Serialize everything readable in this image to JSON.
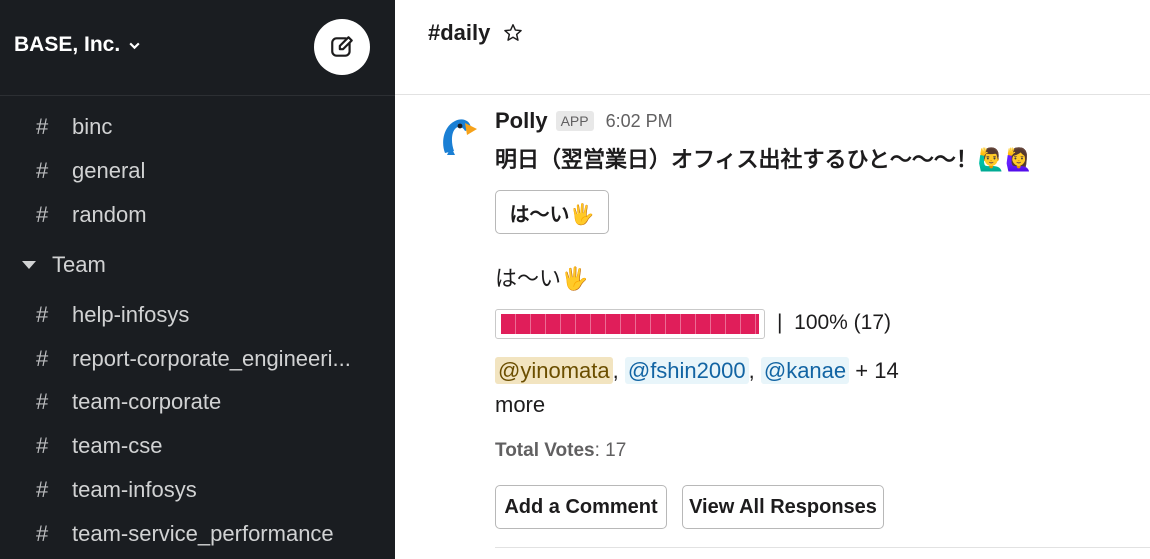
{
  "workspace": {
    "name": "BASE, Inc."
  },
  "sidebar": {
    "channels_top": [
      {
        "hash": "#",
        "label": "binc"
      },
      {
        "hash": "#",
        "label": "general"
      },
      {
        "hash": "#",
        "label": "random"
      }
    ],
    "section": {
      "label": "Team"
    },
    "channels_team": [
      {
        "hash": "#",
        "label": "help-infosys"
      },
      {
        "hash": "#",
        "label": "report-corporate_engineeri..."
      },
      {
        "hash": "#",
        "label": "team-corporate"
      },
      {
        "hash": "#",
        "label": "team-cse"
      },
      {
        "hash": "#",
        "label": "team-infosys"
      },
      {
        "hash": "#",
        "label": "team-service_performance"
      }
    ]
  },
  "channel": {
    "title": "#daily"
  },
  "message": {
    "sender": "Polly",
    "badge": "APP",
    "time": "6:02 PM",
    "text": "明日（翌営業日）オフィス出社するひと〜〜〜！🙋‍♂️🙋‍♀️",
    "vote_button": "は〜い🖐",
    "option": {
      "label": "は〜い🖐",
      "percent": 100,
      "stats_sep": "|",
      "stats": "100% (17)"
    },
    "voters": {
      "names": [
        "@yinomata",
        "@fshin2000",
        "@kanae"
      ],
      "comma": ",",
      "more": "+ 14 more"
    },
    "total": {
      "label": "Total Votes",
      "sep": ":",
      "value": "17"
    },
    "actions": {
      "comment": "Add a Comment",
      "view_all": "View All Responses"
    }
  },
  "colors": {
    "sidebar_bg": "#1a1d21",
    "bar_fill": "#e01e5a",
    "mention": "#1264a3"
  }
}
